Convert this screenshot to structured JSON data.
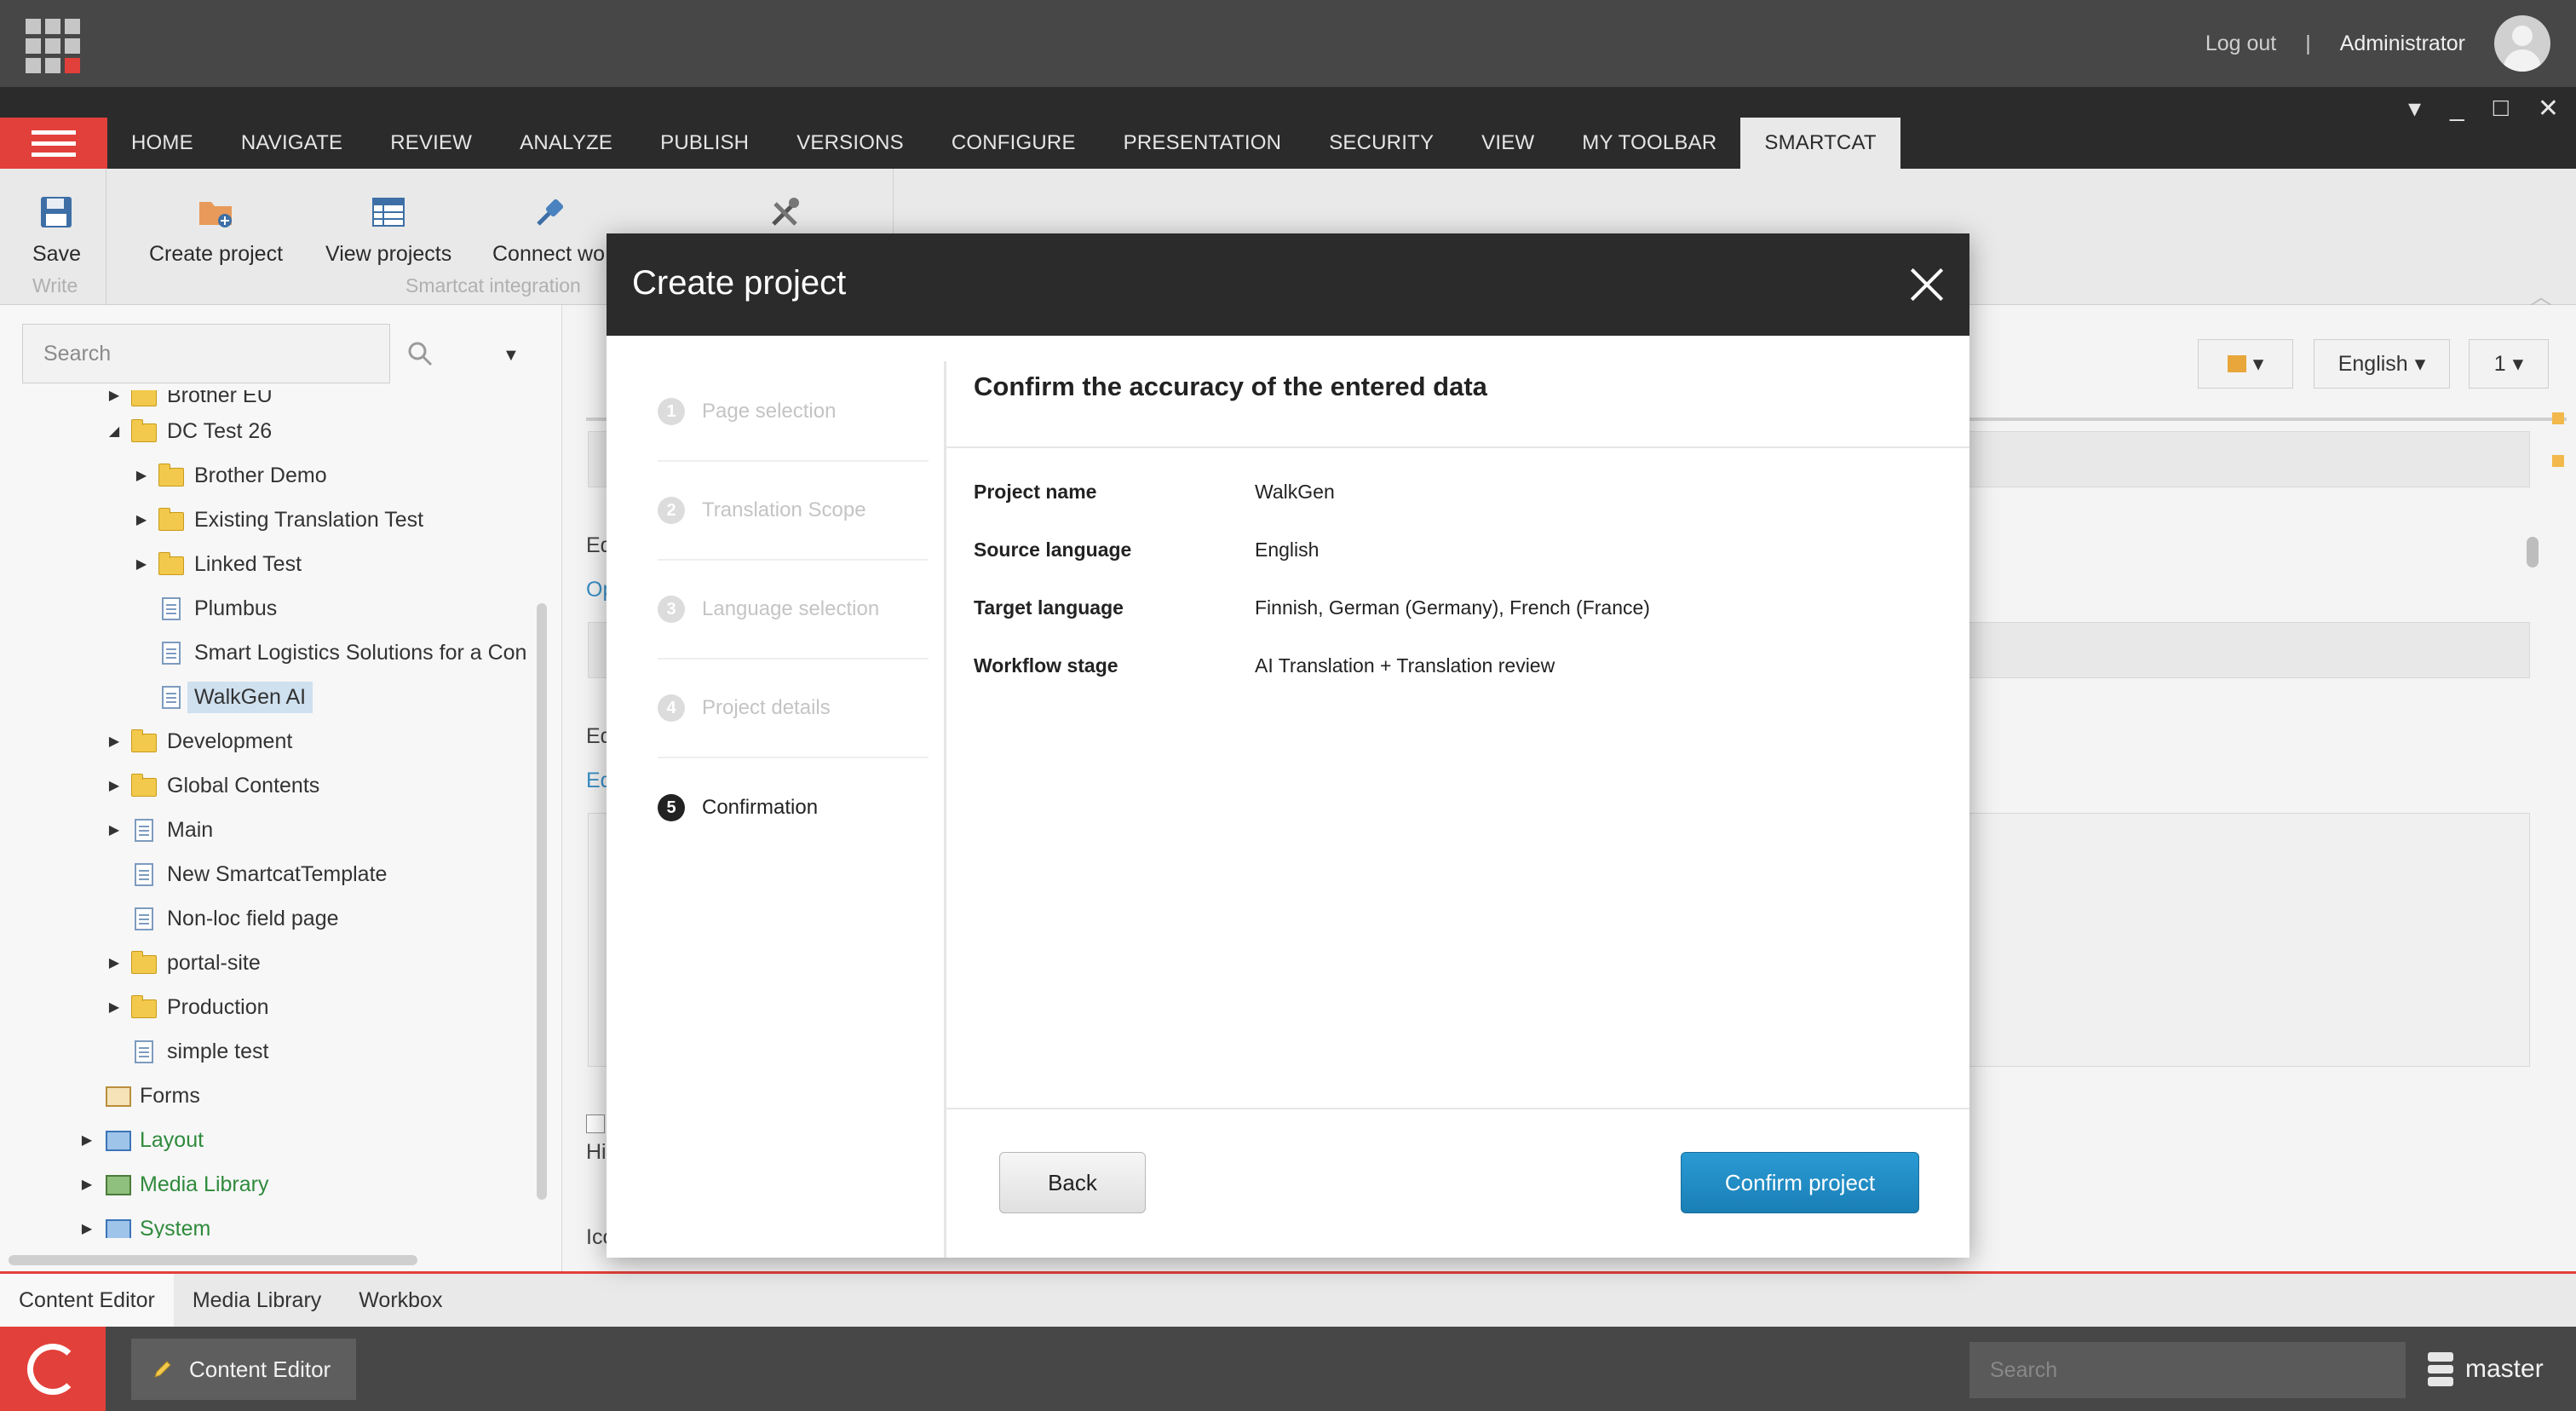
{
  "topbar": {
    "logout_label": "Log out",
    "separator": "|",
    "user_name": "Administrator"
  },
  "ribbon_tabs": [
    {
      "label": "HOME"
    },
    {
      "label": "NAVIGATE"
    },
    {
      "label": "REVIEW"
    },
    {
      "label": "ANALYZE"
    },
    {
      "label": "PUBLISH"
    },
    {
      "label": "VERSIONS"
    },
    {
      "label": "CONFIGURE"
    },
    {
      "label": "PRESENTATION"
    },
    {
      "label": "SECURITY"
    },
    {
      "label": "VIEW"
    },
    {
      "label": "MY TOOLBAR"
    },
    {
      "label": "SMARTCAT",
      "active": true
    }
  ],
  "ribbon": {
    "save_label": "Save",
    "write_group": "Write",
    "create_project_label": "Create project",
    "view_projects_label": "View projects",
    "connect_label": "Connect wo",
    "smartcat_group": "Smartcat integration"
  },
  "search": {
    "placeholder": "Search"
  },
  "tree": {
    "items": [
      {
        "label": "Brother EU"
      },
      {
        "label": "DC Test 26"
      },
      {
        "label": "Brother Demo"
      },
      {
        "label": "Existing Translation Test"
      },
      {
        "label": "Linked Test"
      },
      {
        "label": "Plumbus"
      },
      {
        "label": "Smart Logistics Solutions for a Con"
      },
      {
        "label": "WalkGen AI"
      },
      {
        "label": "Development"
      },
      {
        "label": "Global Contents"
      },
      {
        "label": "Main"
      },
      {
        "label": "New SmartcatTemplate"
      },
      {
        "label": "Non-loc field page"
      },
      {
        "label": "portal-site"
      },
      {
        "label": "Production"
      },
      {
        "label": "simple test"
      },
      {
        "label": "Forms"
      },
      {
        "label": "Layout"
      },
      {
        "label": "Media Library"
      },
      {
        "label": "System"
      }
    ]
  },
  "content_bar": {
    "language": "English",
    "version": "1"
  },
  "content_fragments": {
    "f1": "Ed",
    "f2": "Op",
    "f3": "Ed",
    "f4": "Ed",
    "f5": "Hi",
    "f6": "Ico"
  },
  "bottom_tabs": [
    {
      "label": "Content Editor",
      "active": true
    },
    {
      "label": "Media Library"
    },
    {
      "label": "Workbox"
    }
  ],
  "taskbar": {
    "app_label": "Content Editor",
    "search_placeholder": "Search",
    "database": "master"
  },
  "dialog": {
    "title": "Create project",
    "steps": [
      {
        "num": "1",
        "label": "Page selection"
      },
      {
        "num": "2",
        "label": "Translation Scope"
      },
      {
        "num": "3",
        "label": "Language selection"
      },
      {
        "num": "4",
        "label": "Project details"
      },
      {
        "num": "5",
        "label": "Confirmation",
        "current": true
      }
    ],
    "heading": "Confirm the accuracy of the entered data",
    "fields": {
      "project_name": {
        "label": "Project name",
        "value": "WalkGen"
      },
      "source_language": {
        "label": "Source language",
        "value": "English"
      },
      "target_language": {
        "label": "Target language",
        "value": "Finnish, German (Germany), French (France)"
      },
      "workflow_stage": {
        "label": "Workflow stage",
        "value": "AI Translation + Translation review"
      }
    },
    "back_label": "Back",
    "confirm_label": "Confirm project"
  },
  "colors": {
    "accent_red": "#e2403a",
    "confirm_blue": "#1a8ac5",
    "dark_header": "#2b2b2b"
  }
}
